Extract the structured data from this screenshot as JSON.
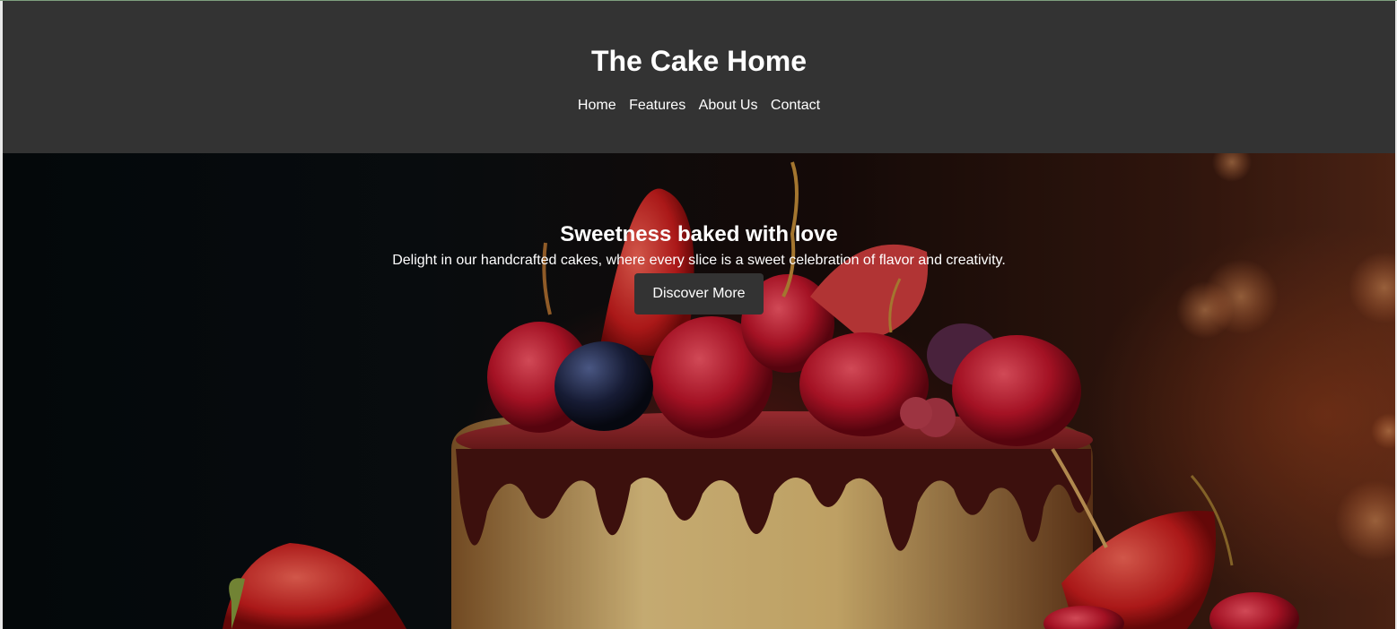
{
  "header": {
    "site_title": "The Cake Home",
    "nav": [
      {
        "label": "Home"
      },
      {
        "label": "Features"
      },
      {
        "label": "About Us"
      },
      {
        "label": "Contact"
      }
    ]
  },
  "hero": {
    "title": "Sweetness baked with love",
    "description": "Delight in our handcrafted cakes, where every slice is a sweet celebration of flavor and creativity.",
    "cta_label": "Discover More",
    "image": "cake-with-berries-photo"
  },
  "colors": {
    "header_bg": "#333333",
    "button_bg": "#333333",
    "text": "#ffffff"
  }
}
